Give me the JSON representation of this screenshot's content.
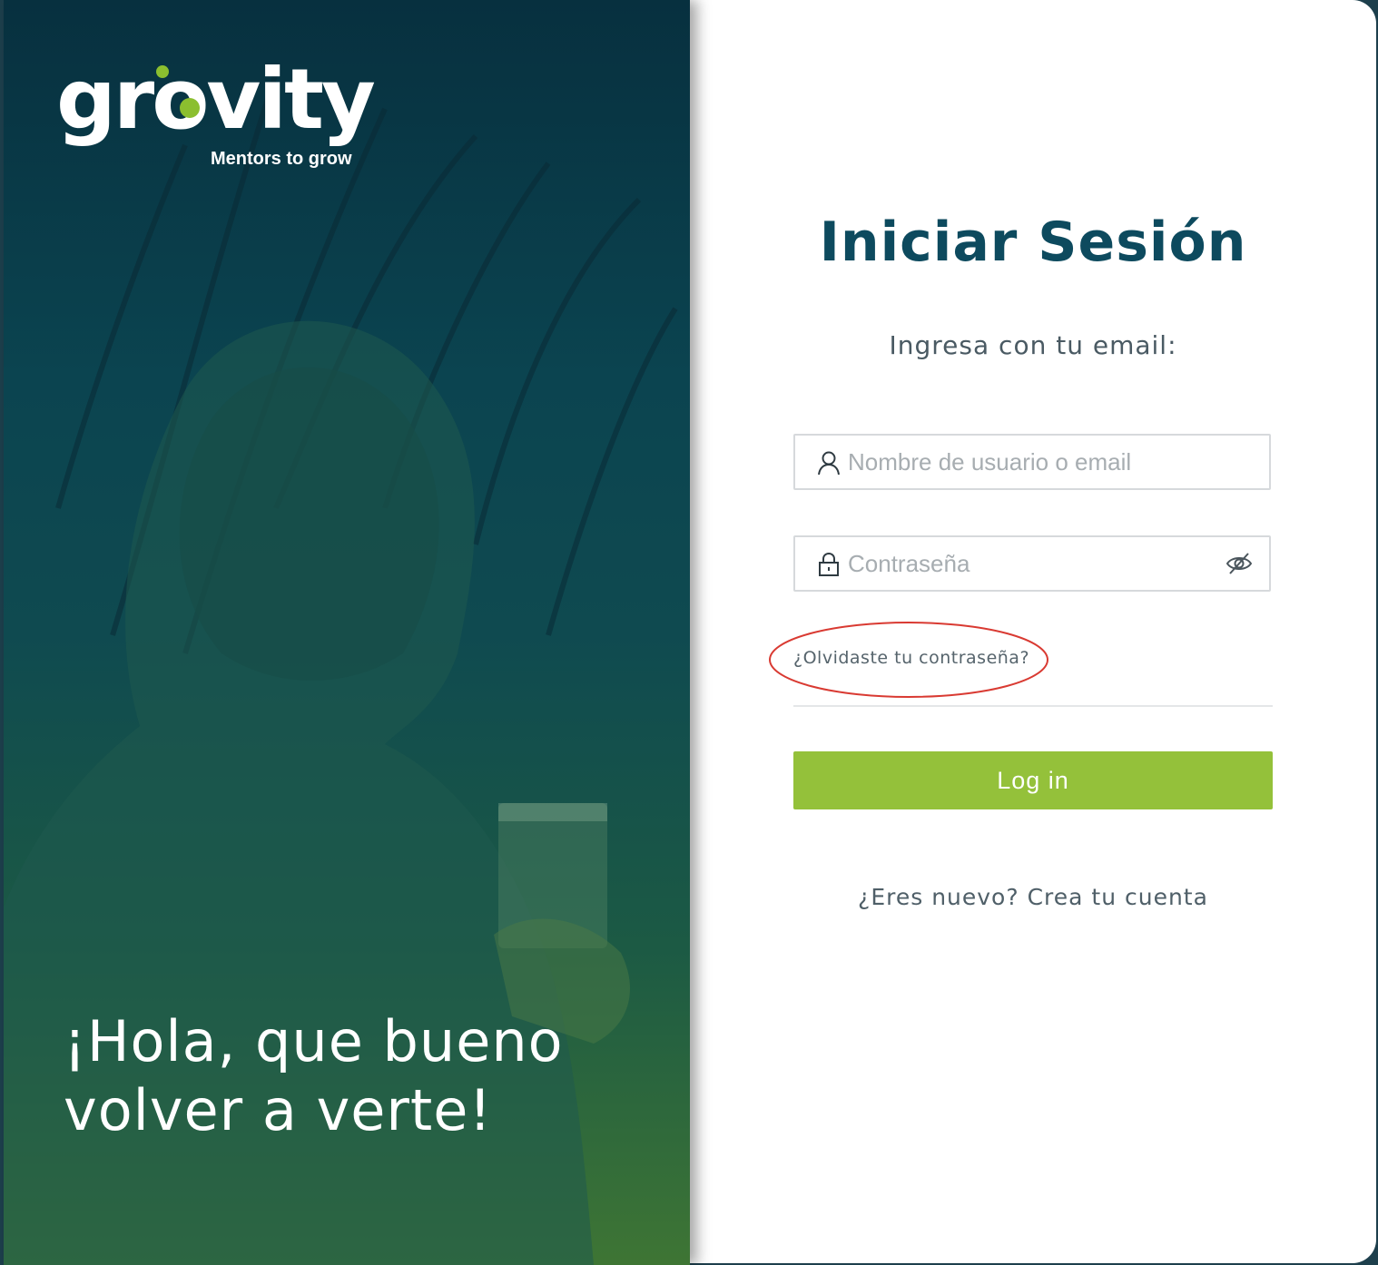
{
  "hero": {
    "logo_text": "grovity",
    "tagline": "Mentors to grow",
    "greeting_line1": "¡Hola, que bueno",
    "greeting_line2": "volver a verte!"
  },
  "form": {
    "title": "Iniciar Sesión",
    "subtitle": "Ingresa con tu email:",
    "username_placeholder": "Nombre de usuario o email",
    "username_value": "",
    "password_placeholder": "Contraseña",
    "password_value": "",
    "forgot_password": "¿Olvidaste tu contraseña?",
    "login_button": "Log in",
    "signup_link": "¿Eres nuevo? Crea tu cuenta"
  },
  "icons": {
    "username": "user-icon",
    "password": "lock-icon",
    "toggle_visibility": "eye-off-icon"
  },
  "colors": {
    "brand_dark": "#0d4a5e",
    "brand_green": "#94c13a",
    "annotation": "#d93a32"
  }
}
